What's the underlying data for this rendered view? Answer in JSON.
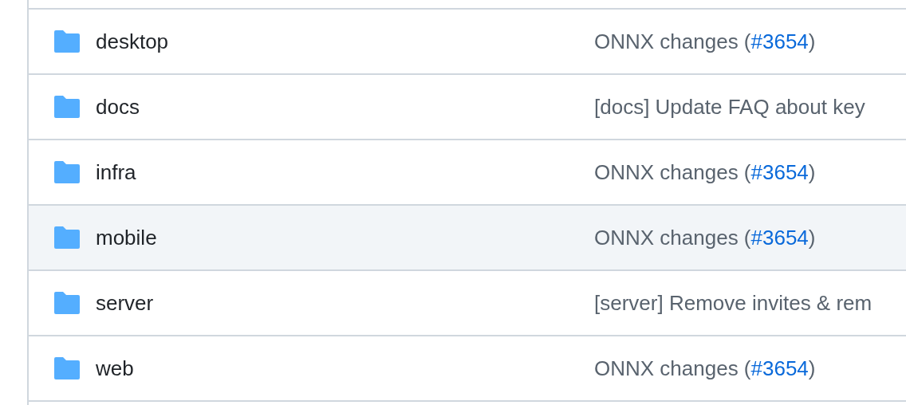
{
  "files": [
    {
      "name": "desktop",
      "highlighted": false,
      "commit": {
        "text": "ONNX changes (",
        "link": "#3654",
        "after": ")"
      }
    },
    {
      "name": "docs",
      "highlighted": false,
      "commit": {
        "text": "[docs] Update FAQ about key"
      }
    },
    {
      "name": "infra",
      "highlighted": false,
      "commit": {
        "text": "ONNX changes (",
        "link": "#3654",
        "after": ")"
      }
    },
    {
      "name": "mobile",
      "highlighted": true,
      "commit": {
        "text": "ONNX changes (",
        "link": "#3654",
        "after": ")"
      }
    },
    {
      "name": "server",
      "highlighted": false,
      "commit": {
        "text": "[server] Remove invites & rem"
      }
    },
    {
      "name": "web",
      "highlighted": false,
      "commit": {
        "text": "ONNX changes (",
        "link": "#3654",
        "after": ")"
      }
    }
  ]
}
